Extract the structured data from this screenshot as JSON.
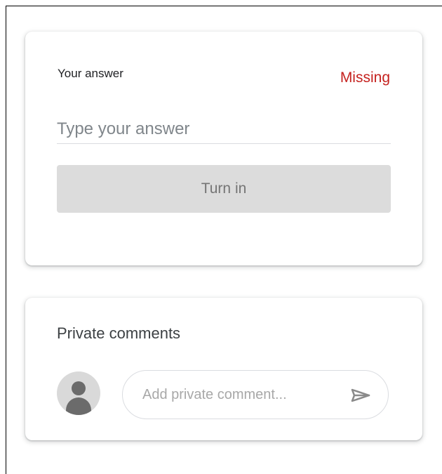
{
  "answer_card": {
    "title": "Your answer",
    "status": "Missing",
    "input_value": "",
    "input_placeholder": "Type your answer",
    "turn_in_label": "Turn in"
  },
  "comments_card": {
    "title": "Private comments",
    "avatar_icon": "avatar-icon",
    "input_value": "",
    "input_placeholder": "Add private comment...",
    "send_icon": "send-icon"
  },
  "colors": {
    "status_missing": "#c5221f",
    "button_disabled_bg": "#dcdcdc",
    "button_disabled_text": "#757575",
    "title_text": "#202124",
    "placeholder_text": "#80868b"
  }
}
